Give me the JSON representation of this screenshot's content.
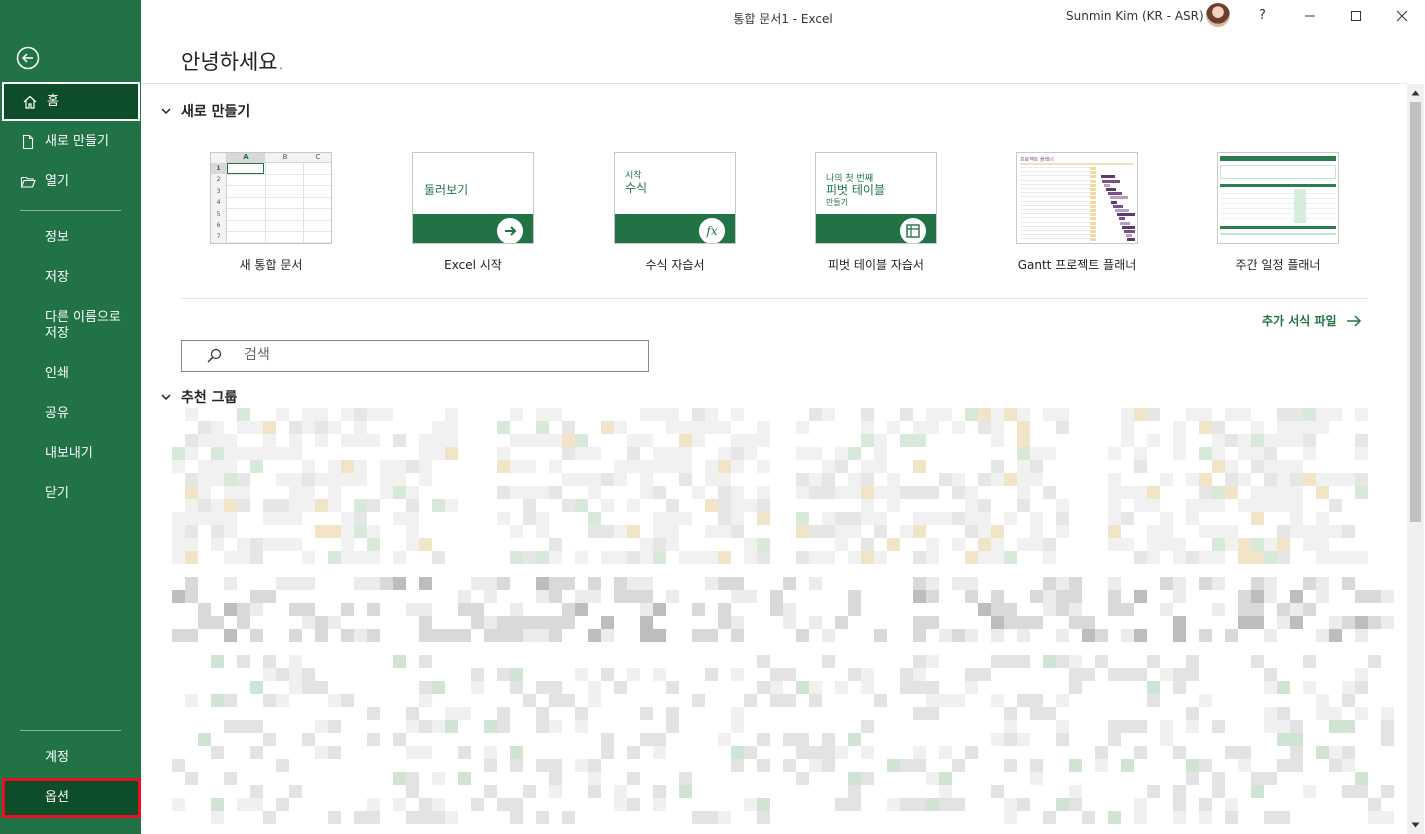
{
  "window": {
    "title": "통합 문서1  -  Excel",
    "user": "Sunmin Kim (KR - ASR)",
    "help": "?"
  },
  "sidebar": {
    "home": "홈",
    "new": "새로 만들기",
    "open": "열기",
    "info": "정보",
    "save": "저장",
    "save_as": "다른 이름으로\n저장",
    "print": "인쇄",
    "share": "공유",
    "export": "내보내기",
    "close": "닫기",
    "account": "계정",
    "options": "옵션"
  },
  "main": {
    "greeting": "안녕하세요.",
    "new_section": "새로 만들기",
    "templates": [
      {
        "label": "새 통합 문서",
        "thumb_text": ""
      },
      {
        "label": "Excel 시작",
        "thumb_text": "둘러보기"
      },
      {
        "label": "수식 자습서",
        "thumb_text_small": "시작",
        "thumb_text": "수식"
      },
      {
        "label": "피벗 테이블 자습서",
        "thumb_text_small": "나의 첫 번째",
        "thumb_text": "피벗 테이블",
        "thumb_text_small2": "만들기"
      },
      {
        "label": "Gantt 프로젝트 플래너",
        "thumb_text": "프로젝트 플래너"
      },
      {
        "label": "주간 일정 플래너",
        "thumb_text": ""
      }
    ],
    "grid_cols": [
      "A",
      "B",
      "C"
    ],
    "grid_rows": [
      "1",
      "2",
      "3",
      "4",
      "5",
      "6",
      "7"
    ],
    "more_templates": "추가 서식 파일",
    "search_placeholder": "검색",
    "recommended_section": "추천 그룹"
  },
  "colors": {
    "brand": "#217346",
    "brand_dark": "#0e4d2a",
    "highlight": "#e81123"
  }
}
